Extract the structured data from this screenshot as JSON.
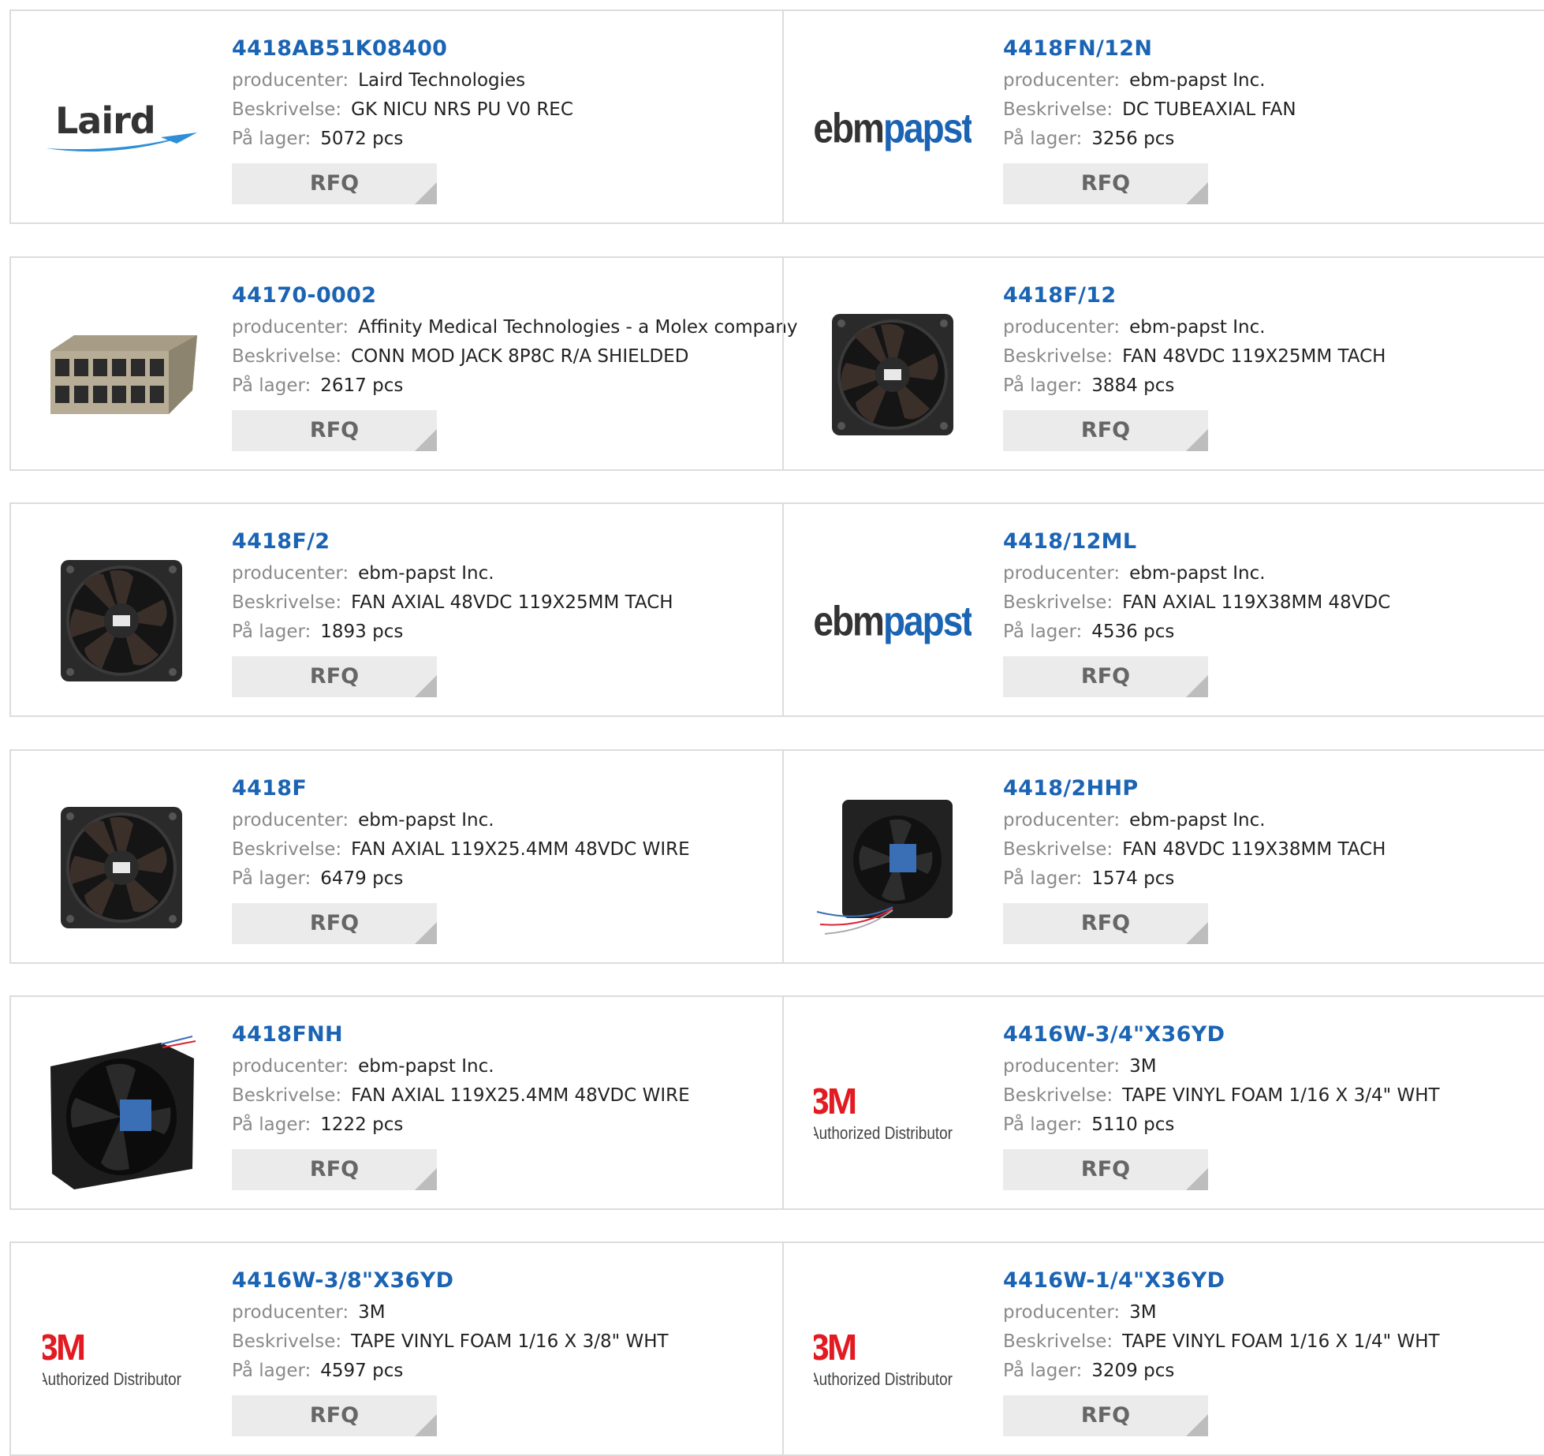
{
  "labels": {
    "manufacturer": "producenter:",
    "description": "Beskrivelse:",
    "stock": "På lager:",
    "rfq": "RFQ"
  },
  "logos": {
    "laird": "Laird",
    "ebm_a": "ebm",
    "ebm_b": "papst",
    "threem_mark": "3M",
    "threem_sub": "Authorized Distributor"
  },
  "products": [
    {
      "part": "4418AB51K08400",
      "manufacturer": "Laird Technologies",
      "description": "GK NICU NRS PU V0 REC",
      "stock": "5072 pcs",
      "image": "laird-logo"
    },
    {
      "part": "4418FN/12N",
      "manufacturer": "ebm-papst Inc.",
      "description": "DC TUBEAXIAL FAN",
      "stock": "3256 pcs",
      "image": "ebmpapst-logo"
    },
    {
      "part": "44170-0002",
      "manufacturer": "Affinity Medical Technologies - a Molex company",
      "description": "CONN MOD JACK 8P8C R/A SHIELDED",
      "stock": "2617 pcs",
      "image": "modular-jack-photo"
    },
    {
      "part": "4418F/12",
      "manufacturer": "ebm-papst Inc.",
      "description": "FAN 48VDC 119X25MM TACH",
      "stock": "3884 pcs",
      "image": "fan-photo"
    },
    {
      "part": "4418F/2",
      "manufacturer": "ebm-papst Inc.",
      "description": "FAN AXIAL 48VDC 119X25MM TACH",
      "stock": "1893 pcs",
      "image": "fan-photo"
    },
    {
      "part": "4418/12ML",
      "manufacturer": "ebm-papst Inc.",
      "description": "FAN AXIAL 119X38MM 48VDC",
      "stock": "4536 pcs",
      "image": "ebmpapst-logo"
    },
    {
      "part": "4418F",
      "manufacturer": "ebm-papst Inc.",
      "description": "FAN AXIAL 119X25.4MM 48VDC WIRE",
      "stock": "6479 pcs",
      "image": "fan-photo"
    },
    {
      "part": "4418/2HHP",
      "manufacturer": "ebm-papst Inc.",
      "description": "FAN 48VDC 119X38MM TACH",
      "stock": "1574 pcs",
      "image": "fan-wired-photo"
    },
    {
      "part": "4418FNH",
      "manufacturer": "ebm-papst Inc.",
      "description": "FAN AXIAL 119X25.4MM 48VDC WIRE",
      "stock": "1222 pcs",
      "image": "fan-angled-photo"
    },
    {
      "part": "4416W-3/4\"X36YD",
      "manufacturer": "3M",
      "description": "TAPE VINYL FOAM 1/16 X 3/4\" WHT",
      "stock": "5110 pcs",
      "image": "3m-logo"
    },
    {
      "part": "4416W-3/8\"X36YD",
      "manufacturer": "3M",
      "description": "TAPE VINYL FOAM 1/16 X 3/8\" WHT",
      "stock": "4597 pcs",
      "image": "3m-logo"
    },
    {
      "part": "4416W-1/4\"X36YD",
      "manufacturer": "3M",
      "description": "TAPE VINYL FOAM 1/16 X 1/4\" WHT",
      "stock": "3209 pcs",
      "image": "3m-logo"
    }
  ]
}
